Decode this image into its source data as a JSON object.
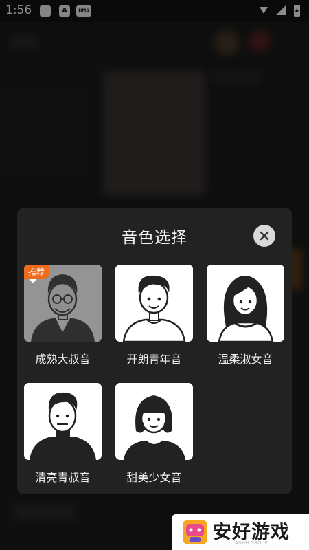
{
  "status_bar": {
    "time": "1:56",
    "badge_a": "A",
    "badge_hms": "HMS"
  },
  "dialog": {
    "title": "音色选择",
    "recommend_badge": "推荐",
    "voices": [
      {
        "label": "成熟大叔音",
        "selected": true
      },
      {
        "label": "开朗青年音",
        "selected": false
      },
      {
        "label": "温柔淑女音",
        "selected": false
      },
      {
        "label": "清亮青叔音",
        "selected": false
      },
      {
        "label": "甜美少女音",
        "selected": false
      }
    ]
  },
  "watermark": {
    "text": "安好游戏",
    "sub": "ANHH.GROUP"
  },
  "colors": {
    "accent": "#ef6a19",
    "dialog_bg": "#222222",
    "close_bg": "#d9d9d9"
  }
}
